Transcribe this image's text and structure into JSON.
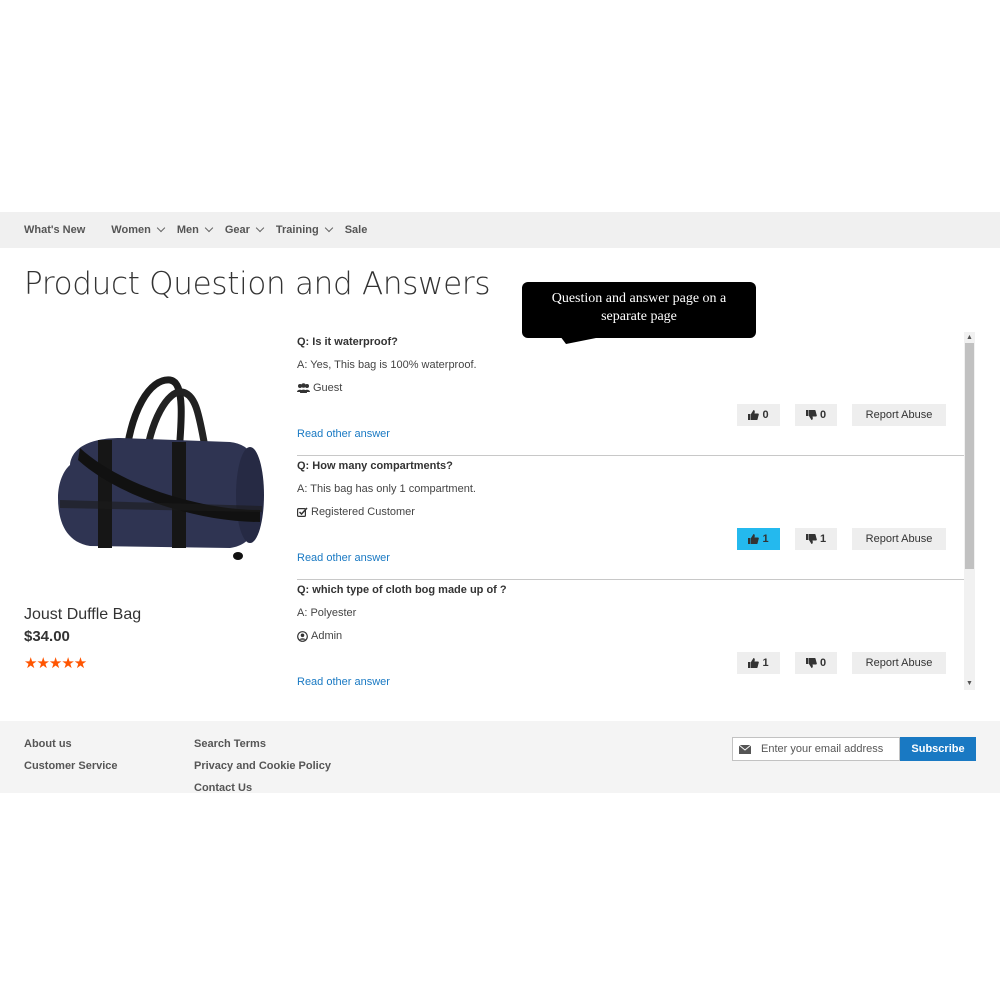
{
  "nav": {
    "items": [
      {
        "label": "What's New",
        "has_dropdown": false
      },
      {
        "label": "Women",
        "has_dropdown": true
      },
      {
        "label": "Men",
        "has_dropdown": true
      },
      {
        "label": "Gear",
        "has_dropdown": true
      },
      {
        "label": "Training",
        "has_dropdown": true
      },
      {
        "label": "Sale",
        "has_dropdown": false
      }
    ]
  },
  "page_title": "Product Question and Answers",
  "callout": "Question and answer page on a separate page",
  "product": {
    "name": "Joust Duffle Bag",
    "price": "$34.00",
    "rating": "★★★★★",
    "image_icon": "duffle-bag-image",
    "star_color": "#ff5501"
  },
  "qa": [
    {
      "question": "Q: Is it waterproof?",
      "answer": "A: Yes, This bag is 100% waterproof.",
      "user": "Guest",
      "user_icon": "users-icon",
      "likes": "0",
      "dislikes": "0",
      "like_active": false,
      "report_label": "Report Abuse",
      "read_more": "Read other answer"
    },
    {
      "question": "Q: How many compartments?",
      "answer": "A: This bag has only 1 compartment.",
      "user": "Registered Customer",
      "user_icon": "checkbox-icon",
      "likes": "1",
      "dislikes": "1",
      "like_active": true,
      "report_label": "Report Abuse",
      "read_more": "Read other answer"
    },
    {
      "question": "Q: which type of cloth bog made up of ?",
      "answer": "A: Polyester",
      "user": "Admin",
      "user_icon": "user-circle-icon",
      "likes": "1",
      "dislikes": "0",
      "like_active": false,
      "report_label": "Report Abuse",
      "read_more": "Read other answer"
    }
  ],
  "footer": {
    "col1": [
      "About us",
      "Customer Service"
    ],
    "col2": [
      "Search Terms",
      "Privacy and Cookie Policy",
      "Contact Us"
    ],
    "newsletter": {
      "placeholder": "Enter your email address",
      "button": "Subscribe",
      "icon": "envelope-icon"
    }
  },
  "colors": {
    "accent": "#1979c3",
    "active_vote": "#24b9ee",
    "nav_bg": "#f0f0f0"
  }
}
